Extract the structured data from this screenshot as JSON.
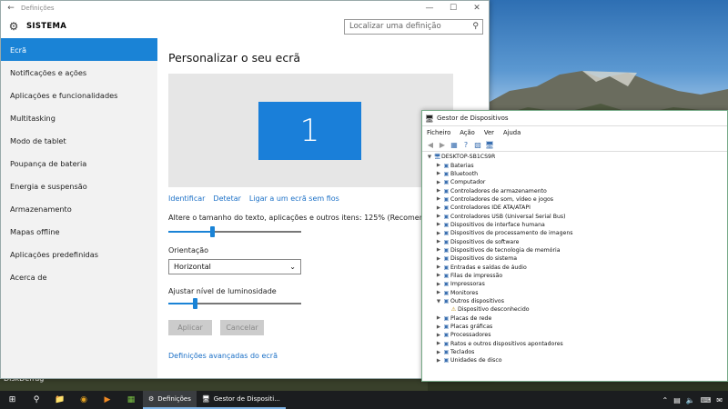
{
  "desktop": {
    "label": "DiskDefrag"
  },
  "settings": {
    "window_title": "Definições",
    "header_title": "SISTEMA",
    "search_placeholder": "Localizar uma definição",
    "nav": [
      "Ecrã",
      "Notificações e ações",
      "Aplicações e funcionalidades",
      "Multitasking",
      "Modo de tablet",
      "Poupança de bateria",
      "Energia e suspensão",
      "Armazenamento",
      "Mapas offline",
      "Aplicações predefinidas",
      "Acerca de"
    ],
    "page_title": "Personalizar o seu ecrã",
    "monitor_number": "1",
    "links": {
      "identify": "Identificar",
      "detect": "Detetar",
      "wireless": "Ligar a um ecrã sem fios"
    },
    "scale_label": "Altere o tamanho do texto, aplicações e outros itens: 125% (Recomendado)",
    "scale_level": 0.33,
    "orientation_label": "Orientação",
    "orientation_value": "Horizontal",
    "brightness_label": "Ajustar nível de luminosidade",
    "brightness_level": 0.2,
    "apply_button": "Aplicar",
    "cancel_button": "Cancelar",
    "advanced_link": "Definições avançadas do ecrã"
  },
  "device_manager": {
    "window_title": "Gestor de Dispositivos",
    "menu": [
      "Ficheiro",
      "Ação",
      "Ver",
      "Ajuda"
    ],
    "root": "DESKTOP-SB1CS9R",
    "categories": [
      "Baterias",
      "Bluetooth",
      "Computador",
      "Controladores de armazenamento",
      "Controladores de som, vídeo e jogos",
      "Controladores IDE ATA/ATAPI",
      "Controladores USB (Universal Serial Bus)",
      "Dispositivos de interface humana",
      "Dispositivos de processamento de imagens",
      "Dispositivos de software",
      "Dispositivos de tecnologia de memória",
      "Dispositivos do sistema",
      "Entradas e saídas de áudio",
      "Filas de impressão",
      "Impressoras",
      "Monitores",
      "Outros dispositivos",
      "Placas de rede",
      "Placas gráficas",
      "Processadores",
      "Ratos e outros dispositivos apontadores",
      "Teclados",
      "Unidades de disco"
    ],
    "expanded_child": "Dispositivo desconhecido"
  },
  "taskbar": {
    "apps": [
      {
        "label": "Definições"
      },
      {
        "label": "Gestor de Dispositi..."
      }
    ],
    "colors": {
      "accent": "#1a83d6",
      "taskbar": "#1b1d1f"
    }
  }
}
